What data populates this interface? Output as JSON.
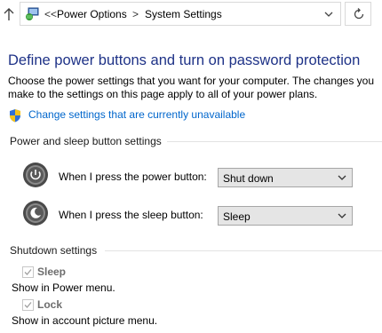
{
  "address_bar": {
    "breadcrumb_overflow": "<<",
    "crumbs": [
      "Power Options",
      "System Settings"
    ],
    "separator": ">",
    "icons": [
      "up-arrow-icon",
      "control-panel-icon",
      "chevron-down-icon",
      "refresh-icon"
    ]
  },
  "page": {
    "title": "Define power buttons and turn on password protection",
    "description": "Choose the power settings that you want for your computer. The changes you make to the settings on this page apply to all of your power plans.",
    "admin_link": "Change settings that are currently unavailable",
    "link_color": "#0066cc",
    "title_color": "#1e3287"
  },
  "power_sleep": {
    "heading": "Power and sleep button settings",
    "rows": [
      {
        "label": "When I press the power button:",
        "value": "Shut down",
        "icon": "power-button-icon"
      },
      {
        "label": "When I press the sleep button:",
        "value": "Sleep",
        "icon": "sleep-button-icon"
      }
    ]
  },
  "shutdown": {
    "heading": "Shutdown settings",
    "options": [
      {
        "label": "Sleep",
        "description": "Show in Power menu.",
        "checked": true,
        "disabled": true
      },
      {
        "label": "Lock",
        "description": "Show in account picture menu.",
        "checked": true,
        "disabled": true
      }
    ]
  }
}
